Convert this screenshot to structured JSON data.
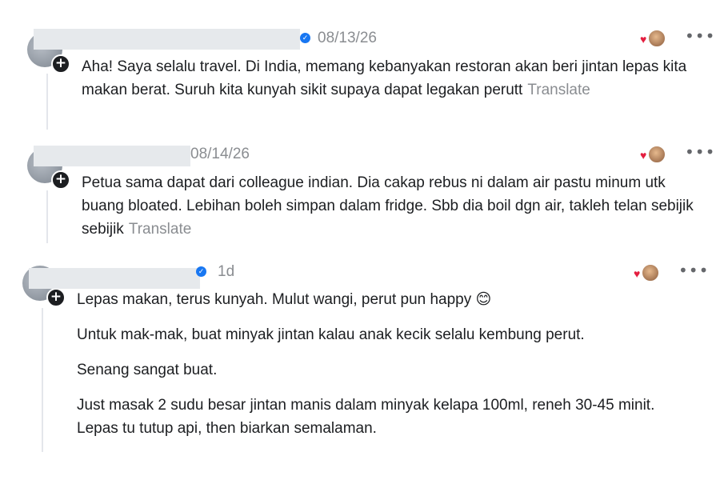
{
  "comments": [
    {
      "date": "08/13/26",
      "text": "Aha! Saya selalu travel. Di India, memang kebanyakan restoran akan beri jintan lepas kita makan berat. Suruh kita kunyah sikit supaya dapat legakan perutt",
      "translate": "Translate"
    },
    {
      "date": "08/14/26",
      "text": "Petua sama dapat dari colleague indian. Dia cakap rebus ni dalam air pastu minum utk buang bloated. Lebihan boleh simpan dalam fridge. Sbb dia boil dgn air, takleh telan sebijik sebijik",
      "translate": "Translate"
    },
    {
      "date": "1d",
      "paragraphs": [
        "Lepas makan, terus kunyah. Mulut wangi, perut pun happy 😊",
        "Untuk mak-mak, buat minyak jintan kalau anak kecik selalu kembung perut.",
        "Senang sangat buat.",
        "Just masak 2 sudu besar jintan manis dalam minyak kelapa 100ml, reneh 30-45 minit. Lepas tu tutup api, then biarkan semalaman."
      ]
    }
  ]
}
